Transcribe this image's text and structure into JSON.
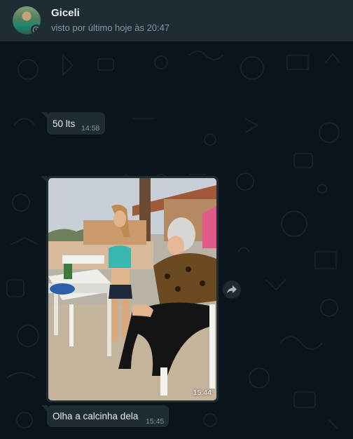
{
  "header": {
    "contact_name": "Giceli",
    "last_seen": "visto por último hoje às 20:47",
    "avatar_icon": "contact-avatar",
    "status_icon": "status-clock-icon"
  },
  "messages": [
    {
      "type": "text",
      "text": "50 lts",
      "time": "14:58"
    },
    {
      "type": "image",
      "time": "15:44",
      "forward_icon": "forward-arrow-icon"
    },
    {
      "type": "text",
      "text": "Olha a calcinha dela",
      "time": "15:45"
    }
  ],
  "colors": {
    "background": "#0b141a",
    "header": "#202c33",
    "bubble_incoming": "#202c33",
    "text_primary": "#e9edef",
    "text_secondary": "#8696a0"
  }
}
